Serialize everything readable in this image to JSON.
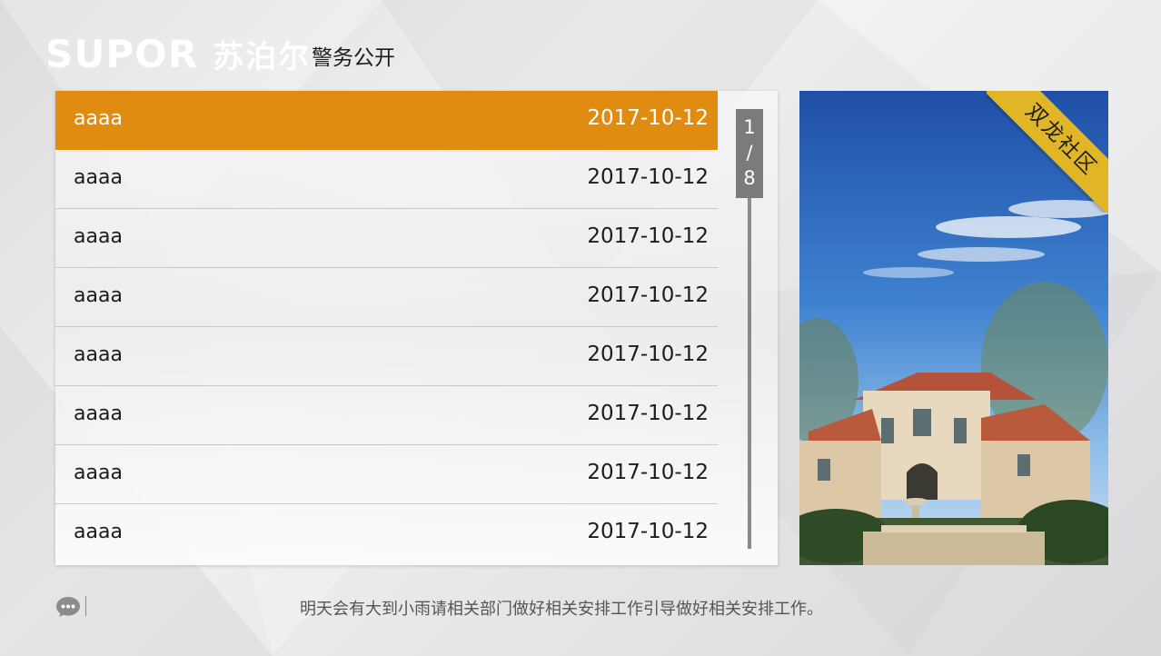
{
  "header": {
    "logo_en": "SUPOR",
    "logo_cn": "苏泊尔",
    "page_title": "警务公开"
  },
  "list": {
    "items": [
      {
        "title": "aaaa",
        "date": "2017-10-12",
        "active": true
      },
      {
        "title": "aaaa",
        "date": "2017-10-12",
        "active": false
      },
      {
        "title": "aaaa",
        "date": "2017-10-12",
        "active": false
      },
      {
        "title": "aaaa",
        "date": "2017-10-12",
        "active": false
      },
      {
        "title": "aaaa",
        "date": "2017-10-12",
        "active": false
      },
      {
        "title": "aaaa",
        "date": "2017-10-12",
        "active": false
      },
      {
        "title": "aaaa",
        "date": "2017-10-12",
        "active": false
      },
      {
        "title": "aaaa",
        "date": "2017-10-12",
        "active": false
      }
    ],
    "active_color": "#e08c10"
  },
  "pager": {
    "current": "1",
    "separator": "/",
    "total": "8"
  },
  "photo": {
    "ribbon_label": "双龙社区",
    "ribbon_color": "#e0b526",
    "subject": "villa-photo"
  },
  "footer": {
    "icon": "chat-icon",
    "notice": "明天会有大到小雨请相关部门做好相关安排工作引导做好相关安排工作。"
  }
}
